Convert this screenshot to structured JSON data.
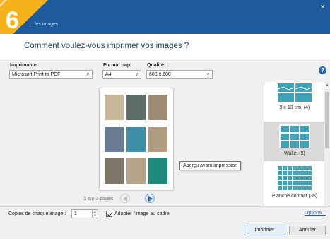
{
  "window": {
    "title": "… les images",
    "close_glyph": "×",
    "step_number": "6"
  },
  "header": {
    "heading": "Comment voulez-vous imprimer vos images ?"
  },
  "options": {
    "printer_label": "Imprimante :",
    "printer_value": "Microsoft Print to PDF",
    "paper_label": "Format pap :",
    "paper_value": "A4",
    "quality_label": "Qualité :",
    "quality_value": "600 x 600",
    "dropdown_glyph": "∨",
    "help_glyph": "?"
  },
  "preview": {
    "tooltip": "Aperçu avant impression",
    "page_indicator": "1 sur 3 pages",
    "photo_colors": [
      "#c9b79a",
      "#5d6d6a",
      "#9d8c73",
      "#6a7d95",
      "#3f8fa9",
      "#b09a80",
      "#7d7768",
      "#b7a58a",
      "#1f8a7f"
    ]
  },
  "layouts": {
    "items": [
      {
        "caption": "9 x 13 cm. (4)"
      },
      {
        "caption": "Wallet (9)"
      },
      {
        "caption": "Planche contact (35)"
      }
    ],
    "selected": "Wallet (9)"
  },
  "footer": {
    "copies_label": "Copies de chaque image :",
    "copies_value": "1",
    "fit_label": "Adapter l'image au cadre",
    "fit_checked": true,
    "options_link": "Options...",
    "print_button": "Imprimer",
    "cancel_button": "Annuler"
  },
  "colors": {
    "title_bar": "#1d5b9c",
    "accent": "#2a69b7",
    "badge": "#f6b21b",
    "link": "#1d5bc0"
  }
}
